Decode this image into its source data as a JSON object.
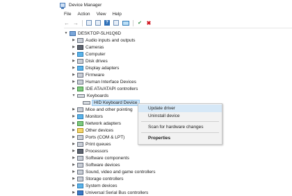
{
  "window": {
    "title": "Device Manager"
  },
  "menu": [
    "File",
    "Action",
    "View",
    "Help"
  ],
  "toolbar": {
    "back": "←",
    "forward": "→",
    "help": "?",
    "enable": "✔",
    "uninstall": "✖"
  },
  "tree": {
    "root": "DESKTOP-5LH1Q6D",
    "categories": [
      "Audio inputs and outputs",
      "Cameras",
      "Computer",
      "Disk drives",
      "Display adapters",
      "Firmware",
      "Human Interface Devices",
      "IDE ATA/ATAPI controllers",
      "Keyboards",
      "HID Keyboard Device",
      "Mice and other pointing",
      "Monitors",
      "Network adapters",
      "Other devices",
      "Ports (COM & LPT)",
      "Print queues",
      "Processors",
      "Software components",
      "Software devices",
      "Sound, video and game controllers",
      "Storage controllers",
      "System devices",
      "Universal Serial Bus controllers"
    ]
  },
  "context_menu": {
    "items": [
      "Update driver",
      "Uninstall device",
      "Scan for hardware changes",
      "Properties"
    ]
  }
}
